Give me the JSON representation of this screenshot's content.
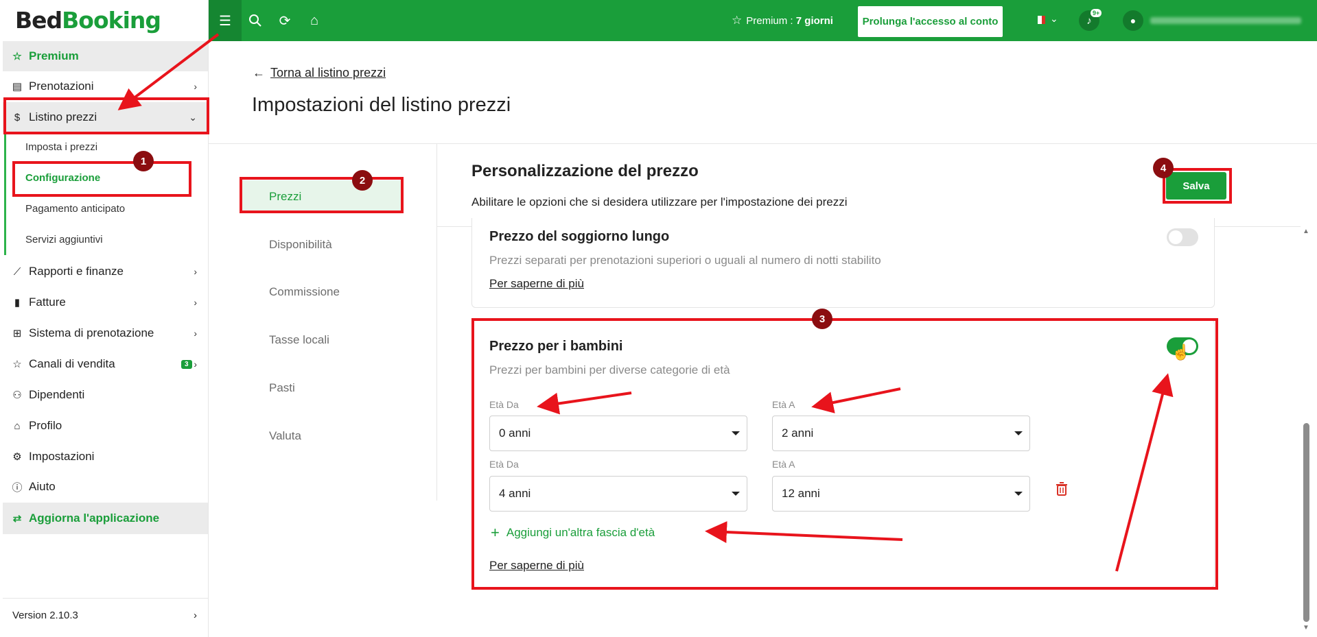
{
  "app": {
    "logo_part1": "Bed",
    "logo_part2": "Booking"
  },
  "sidebar": {
    "premium": "Premium",
    "items": [
      {
        "label": "Prenotazioni"
      },
      {
        "label": "Listino prezzi"
      },
      {
        "label": "Rapporti e finanze"
      },
      {
        "label": "Fatture"
      },
      {
        "label": "Sistema di prenotazione"
      },
      {
        "label": "Canali di vendita",
        "badge": "3"
      },
      {
        "label": "Dipendenti"
      },
      {
        "label": "Profilo"
      },
      {
        "label": "Impostazioni"
      },
      {
        "label": "Aiuto"
      }
    ],
    "subitems": [
      "Imposta i prezzi",
      "Configurazione",
      "Pagamento anticipato",
      "Servizi aggiuntivi"
    ],
    "update_app": "Aggiorna l'applicazione",
    "version": "Version 2.10.3"
  },
  "topbar": {
    "premium_label": "Premium : ",
    "premium_days": "7 giorni",
    "extend_button": "Prolunga l'accesso al conto",
    "notifications_badge": "9+",
    "language": "Italiano"
  },
  "page": {
    "back_link": "Torna al listino prezzi",
    "title": "Impostazioni del listino prezzi"
  },
  "settings_nav": [
    "Prezzi",
    "Disponibilità",
    "Commissione",
    "Tasse locali",
    "Pasti",
    "Valuta"
  ],
  "content": {
    "title": "Personalizzazione del prezzo",
    "subtitle": "Abilitare le opzioni che si desidera utilizzare per l'impostazione dei prezzi",
    "save_button": "Salva",
    "long_stay": {
      "title": "Prezzo del soggiorno lungo",
      "description": "Prezzi separati per prenotazioni superiori o uguali al numero di notti stabilito",
      "learn_more": "Per saperne di più",
      "enabled": false
    },
    "children": {
      "title": "Prezzo per i bambini",
      "description": "Prezzi per bambini per diverse categorie di età",
      "enabled": true,
      "age_from_label": "Età Da",
      "age_to_label": "Età A",
      "ranges": [
        {
          "from": "0 anni",
          "to": "2 anni"
        },
        {
          "from": "4 anni",
          "to": "12 anni"
        }
      ],
      "add_range": "Aggiungi un'altra fascia d'età",
      "learn_more": "Per saperne di più"
    }
  },
  "annotations": {
    "step1": "1",
    "step2": "2",
    "step3": "3",
    "step4": "4"
  },
  "colors": {
    "brand_green": "#1a9e3a",
    "annotation_red": "#e8141c",
    "annotation_badge": "#8b0d10"
  }
}
